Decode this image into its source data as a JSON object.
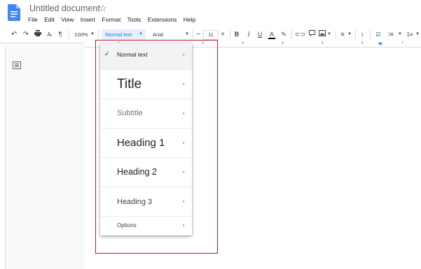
{
  "app": {
    "title": "Untitled document",
    "menu": [
      "File",
      "Edit",
      "View",
      "Insert",
      "Format",
      "Tools",
      "Extensions",
      "Help"
    ]
  },
  "toolbar": {
    "zoom": "100%",
    "style": "Normal text",
    "font": "Arial",
    "font_size": "11",
    "minus": "−",
    "plus": "+",
    "bold": "B",
    "italic": "I",
    "underline": "U",
    "text_color": "A"
  },
  "ruler": {
    "numbers": [
      "1",
      "2",
      "3",
      "4",
      "5",
      "6",
      "7"
    ]
  },
  "dropdown": {
    "items": [
      {
        "label": "Normal text",
        "checked": true
      },
      {
        "label": "Title"
      },
      {
        "label": "Subtitle"
      },
      {
        "label": "Heading 1"
      },
      {
        "label": "Heading 2"
      },
      {
        "label": "Heading 3"
      },
      {
        "label": "Options"
      }
    ],
    "arrow": "▸"
  },
  "colors": {
    "accent": "#1a73e8",
    "highlight_box": "#c8102e"
  }
}
